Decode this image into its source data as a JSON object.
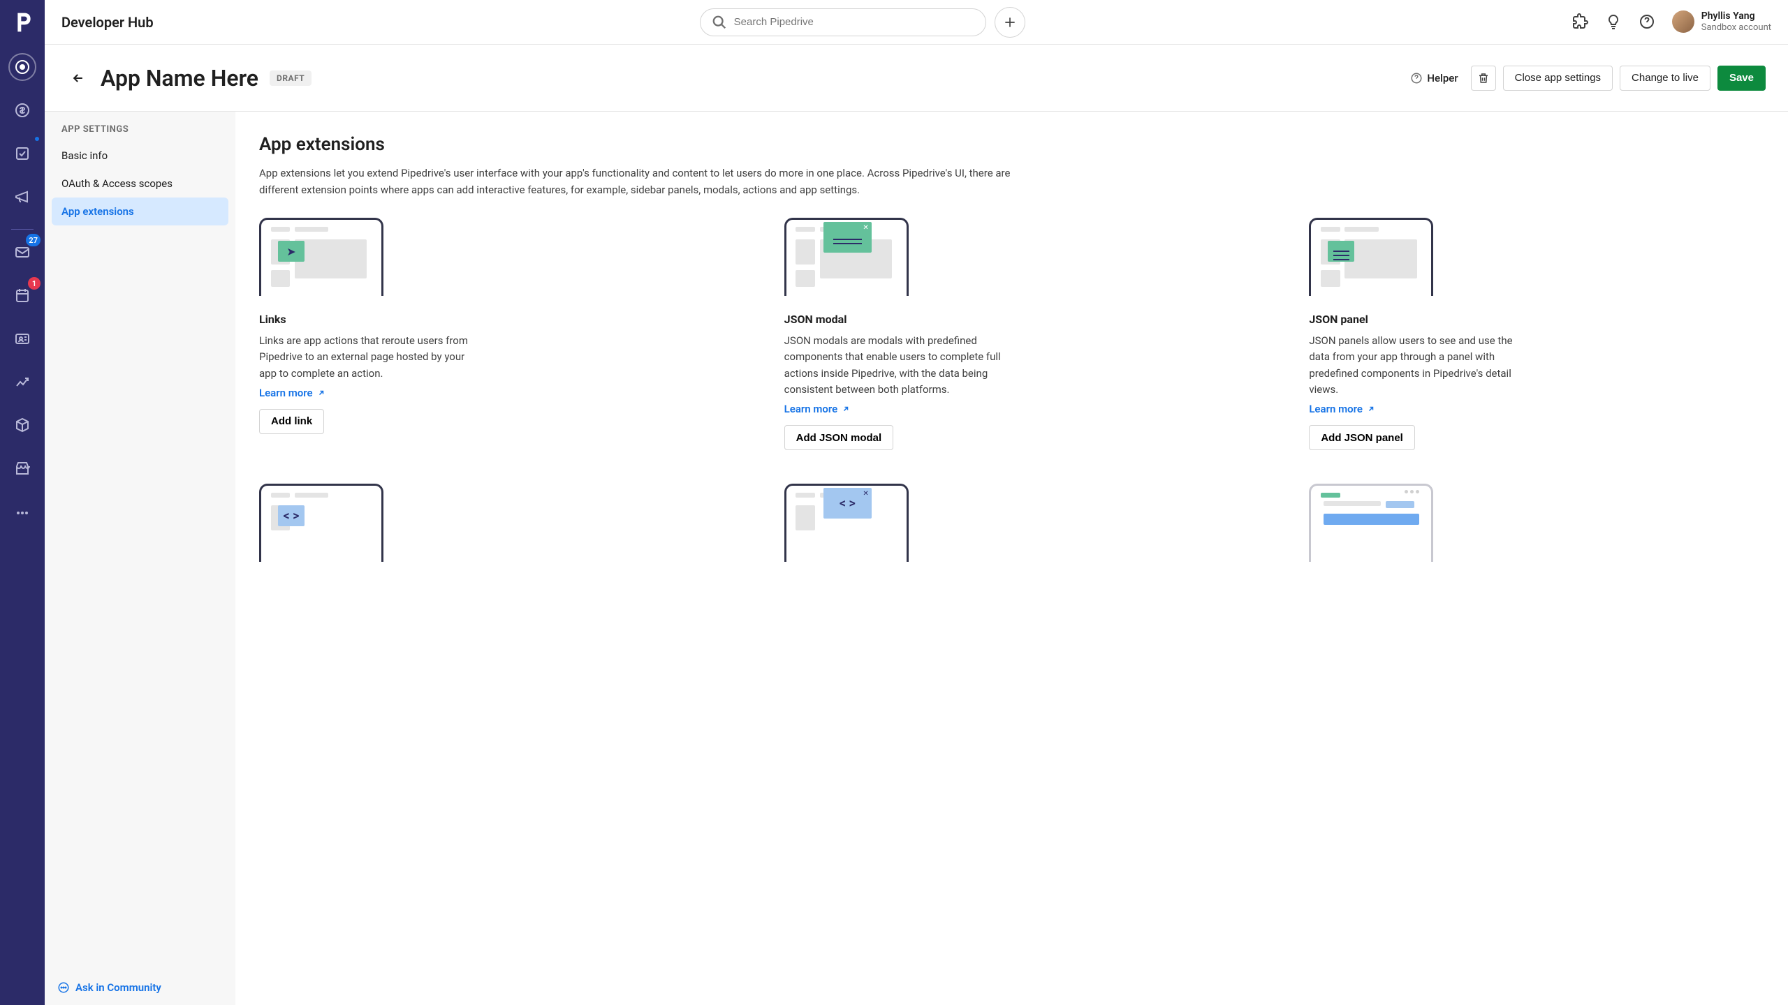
{
  "rail": {
    "badges": {
      "mail": "27",
      "calendar": "1"
    }
  },
  "topbar": {
    "title": "Developer Hub",
    "search_placeholder": "Search Pipedrive",
    "user_name": "Phyllis Yang",
    "user_sub": "Sandbox account"
  },
  "header": {
    "back_label": "Back",
    "app_name": "App Name Here",
    "badge": "DRAFT",
    "helper": "Helper",
    "close_settings": "Close app settings",
    "change_live": "Change to live",
    "save": "Save"
  },
  "sidebar": {
    "heading": "APP SETTINGS",
    "items": [
      {
        "label": "Basic info"
      },
      {
        "label": "OAuth & Access scopes"
      },
      {
        "label": "App extensions"
      }
    ],
    "footer": "Ask in Community"
  },
  "content": {
    "title": "App extensions",
    "desc": "App extensions let you extend Pipedrive's user interface with your app's functionality and content to let users do more in one place. Across Pipedrive's UI, there are different extension points where apps can add interactive features, for example, sidebar panels, modals, actions and app settings.",
    "cards": [
      {
        "title": "Links",
        "desc": "Links are app actions that reroute users from Pipedrive to an external page hosted by your app to complete an action.",
        "learn": "Learn more",
        "button": "Add link"
      },
      {
        "title": "JSON modal",
        "desc": "JSON modals are modals with predefined components that enable users to complete full actions inside Pipedrive, with the data being consistent between both platforms.",
        "learn": "Learn more",
        "button": "Add JSON modal"
      },
      {
        "title": "JSON panel",
        "desc": "JSON panels allow users to see and use the data from your app through a panel with predefined components in Pipedrive's detail views.",
        "learn": "Learn more",
        "button": "Add JSON panel"
      }
    ]
  }
}
